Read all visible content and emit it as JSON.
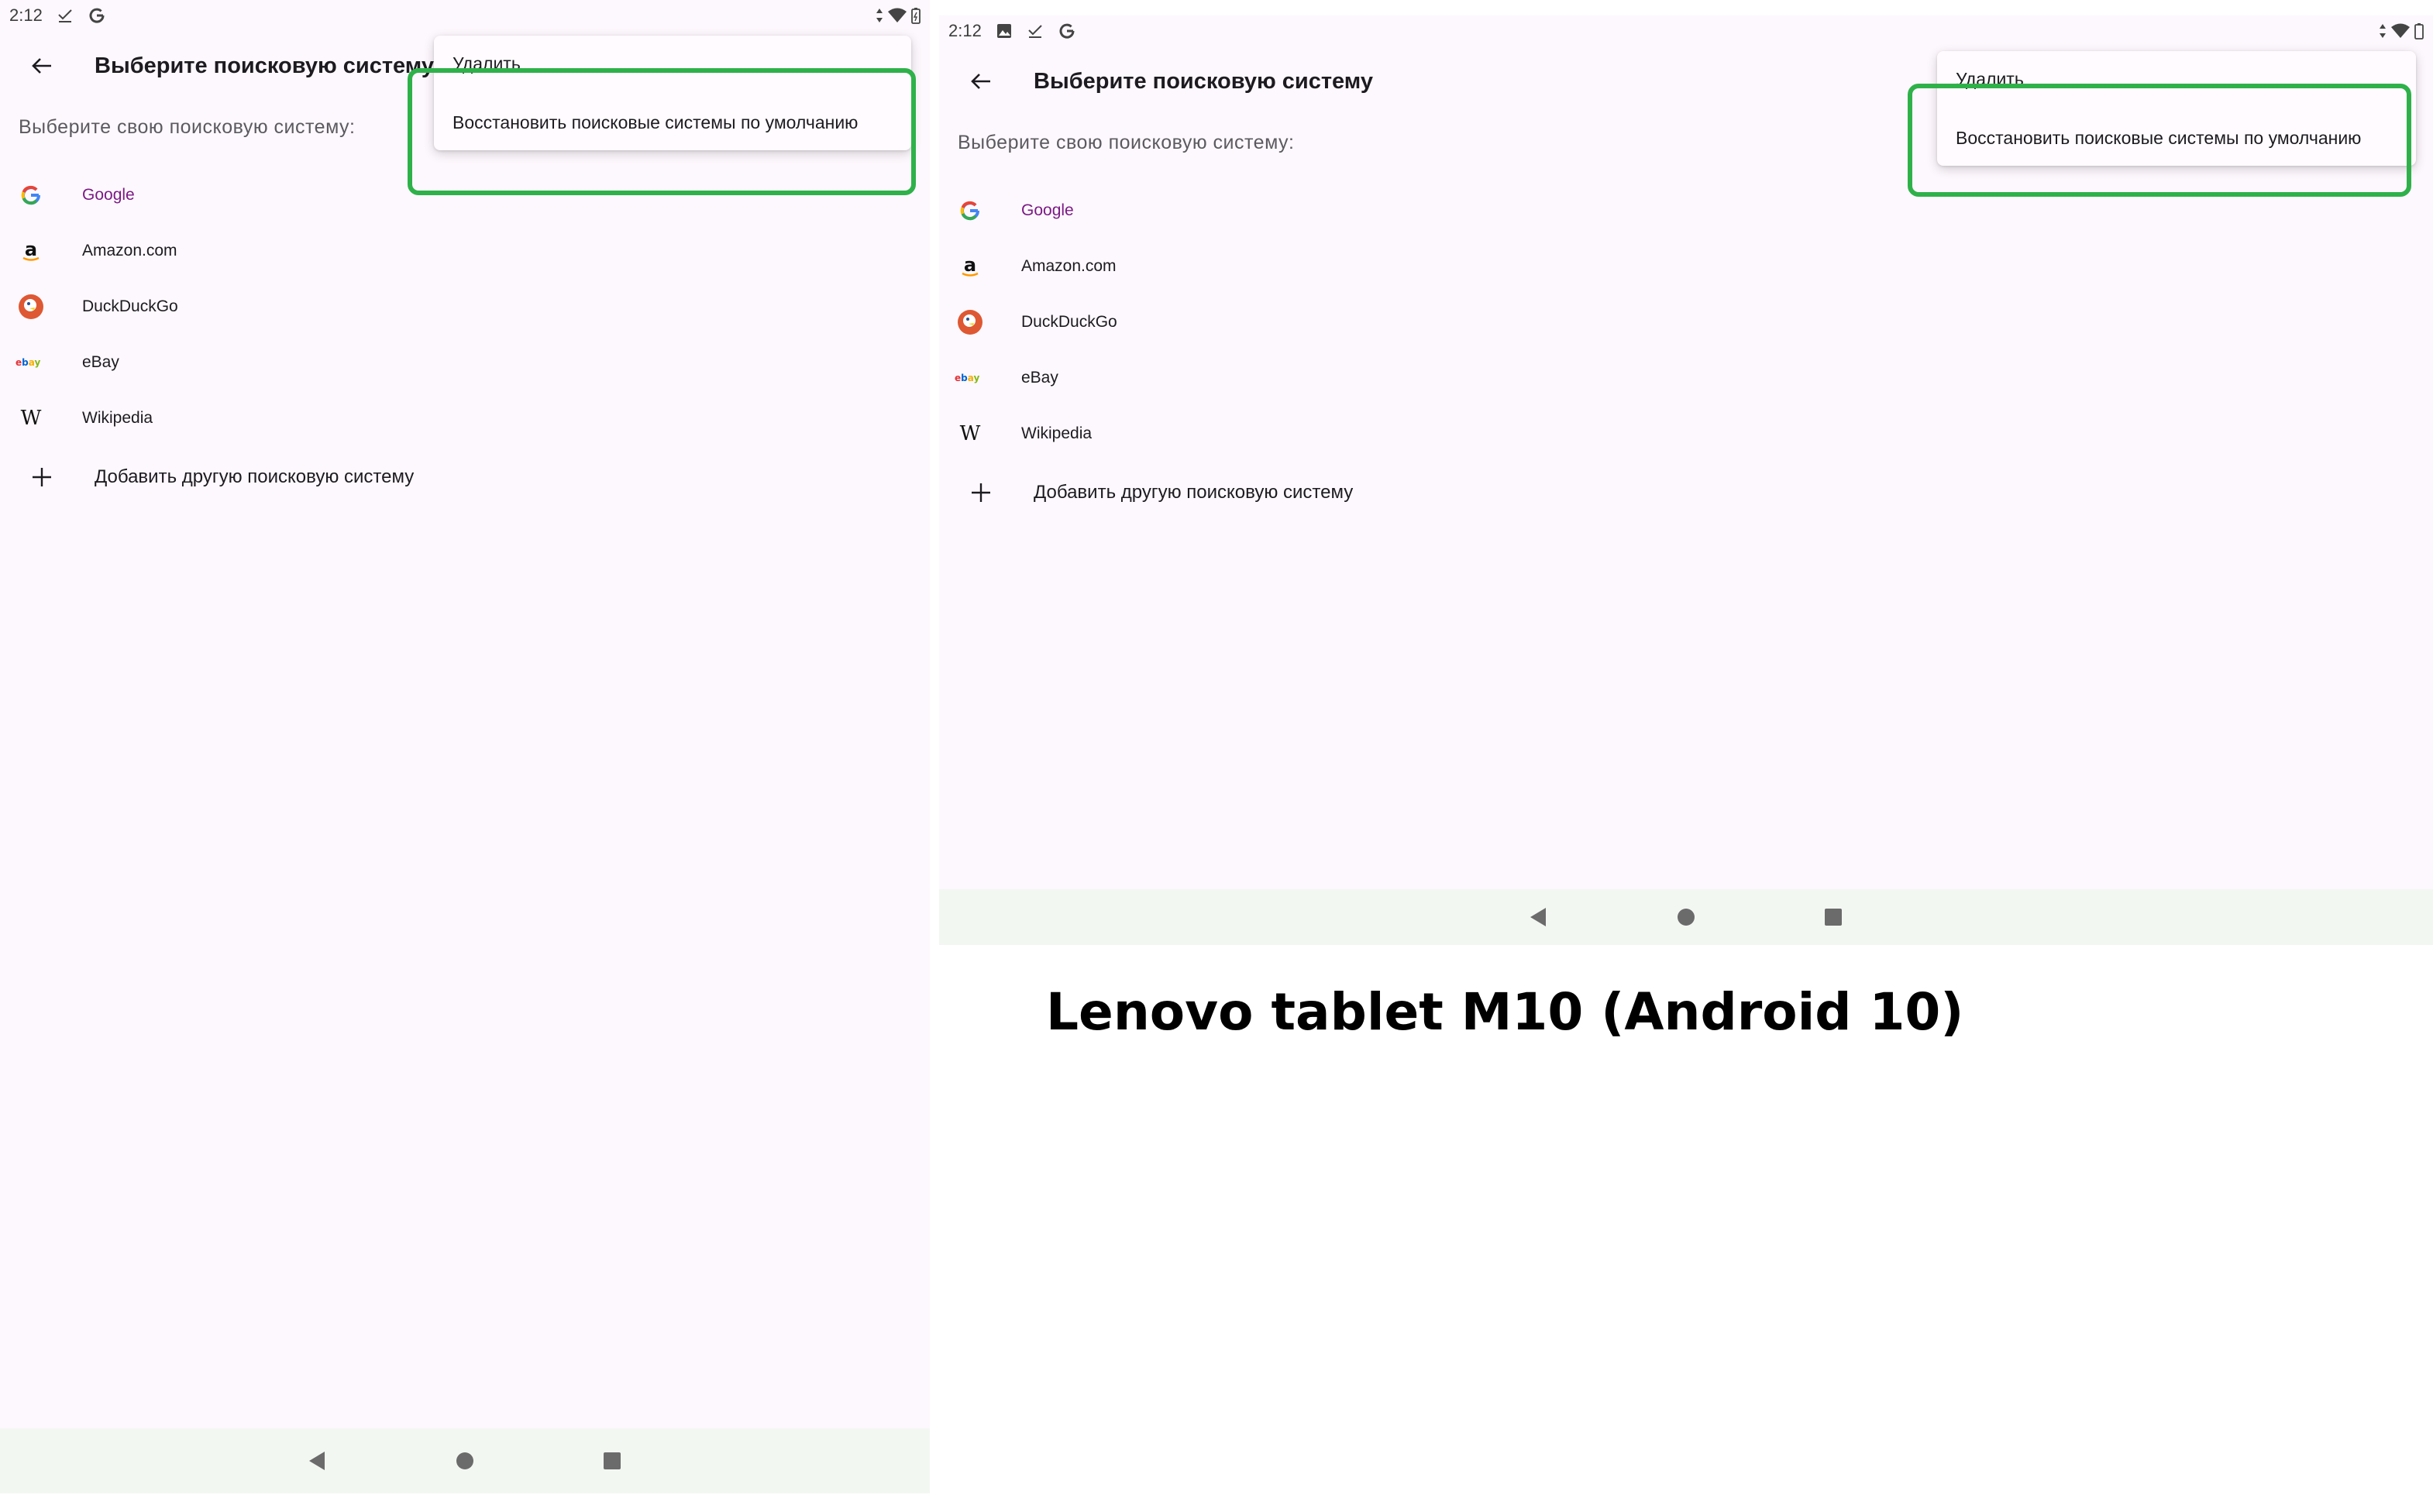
{
  "status_bar": {
    "time": "2:12"
  },
  "app_bar": {
    "title": "Выберите поисковую систему",
    "back_icon": "arrow-back-icon"
  },
  "subtitle": "Выберите свою поисковую систему:",
  "engines": [
    {
      "label": "Google",
      "icon": "google-logo-icon",
      "selected": true
    },
    {
      "label": "Amazon.com",
      "icon": "amazon-logo-icon",
      "selected": false
    },
    {
      "label": "DuckDuckGo",
      "icon": "duckduckgo-logo-icon",
      "selected": false
    },
    {
      "label": "eBay",
      "icon": "ebay-logo-icon",
      "selected": false
    },
    {
      "label": "Wikipedia",
      "icon": "wikipedia-logo-icon",
      "selected": false
    }
  ],
  "add_engine": {
    "label": "Добавить другую поисковую систему",
    "icon": "plus-icon"
  },
  "overflow_menu": {
    "items": [
      {
        "label": "Удалить"
      },
      {
        "label": "Восстановить поисковые системы по умолчанию"
      }
    ]
  },
  "caption": "Lenovo tablet M10 (Android 10)",
  "colors": {
    "highlight": "#2fb14a",
    "selected_text": "#7b1a86",
    "background": "#fdf8fd",
    "navbar": "#f3f7f2"
  }
}
